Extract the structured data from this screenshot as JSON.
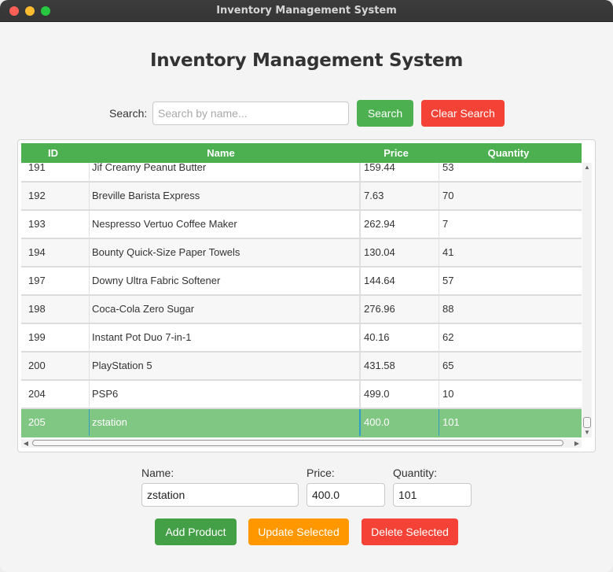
{
  "window": {
    "title": "Inventory Management System"
  },
  "header": {
    "title": "Inventory Management System"
  },
  "search": {
    "label": "Search:",
    "placeholder": "Search by name...",
    "value": "",
    "search_button": "Search",
    "clear_button": "Clear Search"
  },
  "table": {
    "columns": [
      "ID",
      "Name",
      "Price",
      "Quantity"
    ],
    "rows": [
      {
        "id": "191",
        "name": "Jif Creamy Peanut Butter",
        "price": "159.44",
        "quantity": "53"
      },
      {
        "id": "192",
        "name": "Breville Barista Express",
        "price": "7.63",
        "quantity": "70"
      },
      {
        "id": "193",
        "name": "Nespresso Vertuo Coffee Maker",
        "price": "262.94",
        "quantity": "7"
      },
      {
        "id": "194",
        "name": "Bounty Quick-Size Paper Towels",
        "price": "130.04",
        "quantity": "41"
      },
      {
        "id": "197",
        "name": "Downy Ultra Fabric Softener",
        "price": "144.64",
        "quantity": "57"
      },
      {
        "id": "198",
        "name": "Coca-Cola Zero Sugar",
        "price": "276.96",
        "quantity": "88"
      },
      {
        "id": "199",
        "name": "Instant Pot Duo 7-in-1",
        "price": "40.16",
        "quantity": "62"
      },
      {
        "id": "200",
        "name": "PlayStation 5",
        "price": "431.58",
        "quantity": "65"
      },
      {
        "id": "204",
        "name": "PSP6",
        "price": "499.0",
        "quantity": "10"
      },
      {
        "id": "205",
        "name": "zstation",
        "price": "400.0",
        "quantity": "101"
      }
    ],
    "selected_index": 9
  },
  "form": {
    "name_label": "Name:",
    "price_label": "Price:",
    "quantity_label": "Quantity:",
    "name_value": "zstation",
    "price_value": "400.0",
    "quantity_value": "101"
  },
  "actions": {
    "add": "Add Product",
    "update": "Update Selected",
    "delete": "Delete Selected"
  },
  "colors": {
    "header_green": "#4caf50",
    "selected_row": "#81c784",
    "danger_red": "#f44336",
    "warning_orange": "#ff9800",
    "add_green": "#43a047"
  },
  "icons": {
    "scroll_up": "chevron-up-icon",
    "scroll_down": "chevron-down-icon",
    "scroll_left": "chevron-left-icon",
    "scroll_right": "chevron-right-icon"
  }
}
